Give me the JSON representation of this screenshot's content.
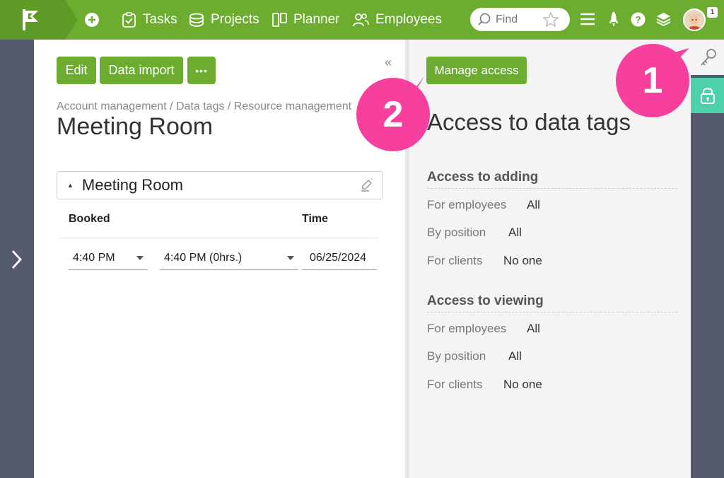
{
  "topbar": {
    "nav": {
      "tasks": "Tasks",
      "projects": "Projects",
      "planner": "Planner",
      "employees": "Employees"
    },
    "search_placeholder": "Find",
    "notification_count": "1"
  },
  "toolbar": {
    "edit_label": "Edit",
    "import_label": "Data import",
    "more_label": "•••",
    "collapse_label": "«"
  },
  "breadcrumb": "Account management / Data tags / Resource management",
  "page_title": "Meeting Room",
  "section": {
    "title": "Meeting Room",
    "columns": {
      "booked": "Booked",
      "time": "Time"
    },
    "start_time": "4:40 PM",
    "end_time": "4:40 PM (0hrs.)",
    "date": "06/25/2024"
  },
  "access": {
    "manage_button": "Manage access",
    "title": "Access to data tags",
    "adding": {
      "heading": "Access to adding",
      "rows": [
        {
          "label": "For employees",
          "value": "All"
        },
        {
          "label": "By position",
          "value": "All"
        },
        {
          "label": "For clients",
          "value": "No one"
        }
      ]
    },
    "viewing": {
      "heading": "Access to viewing",
      "rows": [
        {
          "label": "For employees",
          "value": "All"
        },
        {
          "label": "By position",
          "value": "All"
        },
        {
          "label": "For clients",
          "value": "No one"
        }
      ]
    }
  },
  "callouts": {
    "one": "1",
    "two": "2"
  },
  "colors": {
    "brand_green": "#6cac2f",
    "callout_pink": "#f7409e",
    "lock_teal": "#4cd1a8",
    "sidebar_dark": "#555a6e"
  }
}
